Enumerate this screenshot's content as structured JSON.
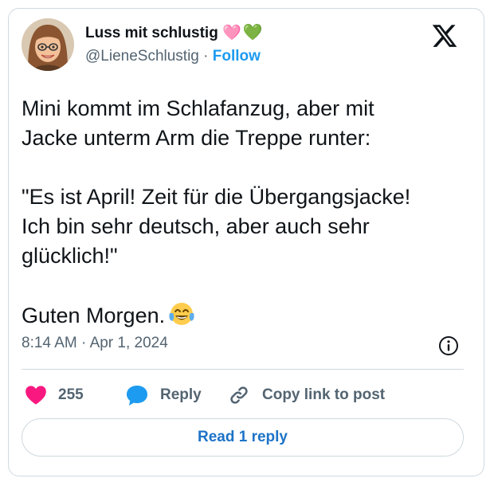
{
  "author": {
    "name": "Luss mit schlustig 🩷",
    "name_emoji": "💚",
    "handle": "@LieneSchlustig",
    "separator": "·",
    "follow_label": "Follow",
    "avatar_icon": "avatar-cartoon-woman"
  },
  "tweet": {
    "lines": [
      "Mini kommt im Schlafanzug, aber mit",
      "Jacke unterm Arm die Treppe runter:",
      "\"Es ist April! Zeit für die Übergangsjacke!",
      "Ich bin sehr deutsch, aber auch sehr",
      "glücklich!\"",
      "Guten Morgen."
    ],
    "end_emoji": "😂"
  },
  "meta": {
    "time": "8:14 AM",
    "separator": "·",
    "date": "Apr 1, 2024"
  },
  "actions": {
    "like_count": "255",
    "reply_label": "Reply",
    "copy_label": "Copy link to post"
  },
  "read_replies_label": "Read 1 reply",
  "colors": {
    "accent": "#1d9bf0",
    "like": "#f91880",
    "text": "#0f1419",
    "muted": "#536471",
    "border": "#cfd9de"
  }
}
